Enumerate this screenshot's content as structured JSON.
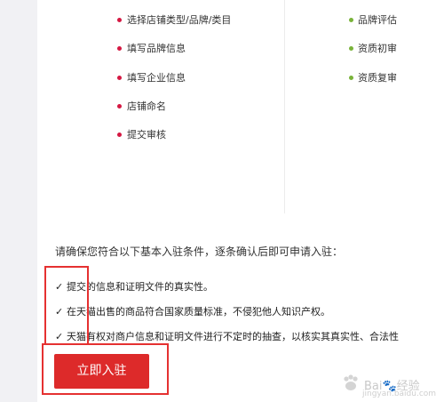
{
  "steps_left": [
    "选择店铺类型/品牌/类目",
    "填写品牌信息",
    "填写企业信息",
    "店铺命名",
    "提交审核"
  ],
  "steps_right": [
    "品牌评估",
    "资质初审",
    "资质复审"
  ],
  "conditions": {
    "intro": "请确保您符合以下基本入驻条件，逐条确认后即可申请入驻：",
    "items": [
      "提交的信息和证明文件的真实性。",
      "在天猫出售的商品符合国家质量标准，不侵犯他人知识产权。",
      "天猫有权对商户信息和证明文件进行不定时的抽查，以核实其真实性、合法性"
    ],
    "check_glyph": "✓"
  },
  "button": {
    "label": "立即入驻"
  },
  "watermark": {
    "text": "Bai🐾经验",
    "sub": "jingyan.baidu.com"
  },
  "colors": {
    "accent_red": "#dd2a2a",
    "bullet_red": "#d51842",
    "bullet_green": "#79b33a",
    "highlight_box": "#e53131"
  }
}
